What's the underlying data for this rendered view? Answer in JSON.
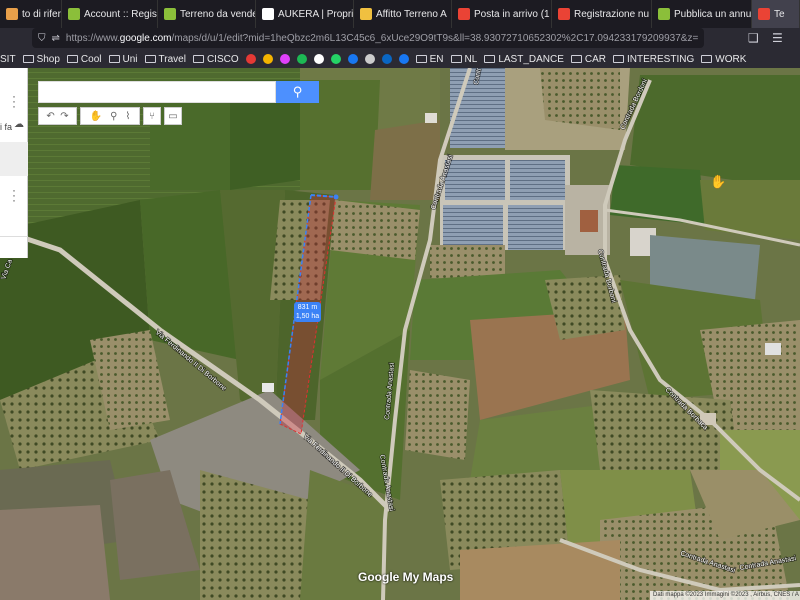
{
  "tabs": [
    {
      "label": "to di riferim",
      "color": "#e8a04a",
      "active": false
    },
    {
      "label": "Account :: Regist",
      "color": "#8bbf3a",
      "active": false
    },
    {
      "label": "Terreno da vende",
      "color": "#8bbf3a",
      "active": false
    },
    {
      "label": "AUKERA | Propri",
      "color": "#ffffff",
      "active": false
    },
    {
      "label": "Affitto Terreno A",
      "color": "#f0c040",
      "active": false
    },
    {
      "label": "Posta in arrivo (1",
      "color": "#ea4335",
      "active": false
    },
    {
      "label": "Registrazione nu",
      "color": "#ea4335",
      "active": false
    },
    {
      "label": "Pubblica un annu",
      "color": "#8bbf3a",
      "active": false
    },
    {
      "label": "Te",
      "color": "#ea4335",
      "active": true
    }
  ],
  "url": {
    "prefix": "https://www.",
    "host": "google.com",
    "path": "/maps/d/u/1/edit?mid=1heQbzc2m6L13C45c6_6xUce29O9tT9s&ll=38.93072710652302%2C17.094233179209937&z=17"
  },
  "bookmarks": [
    {
      "label": "SIT",
      "kind": "text"
    },
    {
      "label": "Shop",
      "kind": "folder"
    },
    {
      "label": "Cool",
      "kind": "folder"
    },
    {
      "label": "Uni",
      "kind": "folder"
    },
    {
      "label": "Travel",
      "kind": "folder"
    },
    {
      "label": "CISCO",
      "kind": "folder"
    },
    {
      "label": "EN",
      "kind": "folder"
    },
    {
      "label": "NL",
      "kind": "folder"
    },
    {
      "label": "LAST_DANCE",
      "kind": "folder"
    },
    {
      "label": "CAR",
      "kind": "folder"
    },
    {
      "label": "INTERESTING",
      "kind": "folder"
    },
    {
      "label": "WORK",
      "kind": "folder"
    }
  ],
  "bookmark_icons": [
    "#e53935",
    "#f4b400",
    "#e040fb",
    "#1db954",
    "#ffffff",
    "#25d366",
    "#1877f2",
    "#cccccc",
    "#0a66c2",
    "#1877f2"
  ],
  "side_panel": {
    "text": "i fa"
  },
  "search": {
    "placeholder": ""
  },
  "measurement": {
    "length": "831 m",
    "area": "1,50 ha"
  },
  "road_labels": {
    "via1": "Via Ferdinando II Di Borbone",
    "via2": "Via Ferdinando II Di Borbone",
    "contrada_anastasi1": "Contrada Anastasi",
    "contrada_anastasi2": "Contrada Anastasi",
    "contrada_anastasi3": "Contrada Anastasi",
    "contrada_anastasi4": "Contrada Anastasi",
    "contrada_anastasi5": "Contrada Anastasi",
    "contrada_borboni1": "Contrada Bordoni",
    "contrada_borboni2": "Contrada Borboni",
    "contrada_borboni3": "Contrada Borboni",
    "contrada_borbaca": "Contrada Borbaca",
    "contrada_top": "Contr",
    "via_cap": "Via Ca"
  },
  "logo": "Google My Maps",
  "attribution": "Dati mappa ©2023 Immagini ©2023 , Airbus, CNES / A"
}
